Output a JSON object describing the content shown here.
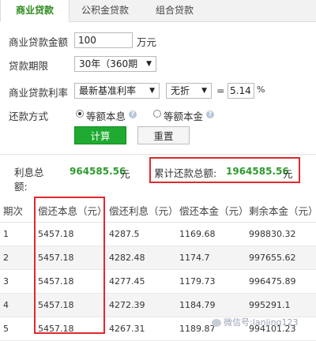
{
  "tabs": [
    {
      "label": "商业贷款",
      "active": true
    },
    {
      "label": "公积金贷款",
      "active": false
    },
    {
      "label": "组合贷款",
      "active": false
    }
  ],
  "form": {
    "amount_label": "商业贷款金额",
    "amount_value": "100",
    "amount_unit": "万元",
    "term_label": "贷款期限",
    "term_value": "30年（360期",
    "rate_label": "商业贷款利率",
    "rate_type_value": "最新基准利率",
    "discount_value": "无折",
    "equals": "=",
    "rate_value": "5.14",
    "rate_unit": "%",
    "method_label": "还款方式",
    "method_options": [
      {
        "label": "等额本息",
        "selected": true
      },
      {
        "label": "等额本金",
        "selected": false
      }
    ],
    "calc_label": "计算",
    "reset_label": "重置"
  },
  "summary": {
    "interest_label_1": "利息总",
    "interest_label_2": "额:",
    "interest_value": "964585.56",
    "interest_unit": "元",
    "total_label": "累计还款总额:",
    "total_value": "1964585.56",
    "total_unit": "元"
  },
  "table": {
    "headers": [
      "期次",
      "偿还本息（元）",
      "偿还利息（元）",
      "偿还本金（元）",
      "剩余本金（元）"
    ],
    "rows": [
      [
        "1",
        "5457.18",
        "4287.5",
        "1169.68",
        "998830.32"
      ],
      [
        "2",
        "5457.18",
        "4282.48",
        "1174.7",
        "997655.62"
      ],
      [
        "3",
        "5457.18",
        "4277.45",
        "1179.73",
        "996475.89"
      ],
      [
        "4",
        "5457.18",
        "4272.39",
        "1184.79",
        "995291.1"
      ],
      [
        "5",
        "5457.18",
        "4267.31",
        "1189.87",
        "994101.23"
      ]
    ]
  },
  "watermark": "微信号:lanjing123",
  "colors": {
    "accent_green": "#1eaa30",
    "value_green": "#2e9a2e",
    "highlight_red": "#e0292e"
  }
}
